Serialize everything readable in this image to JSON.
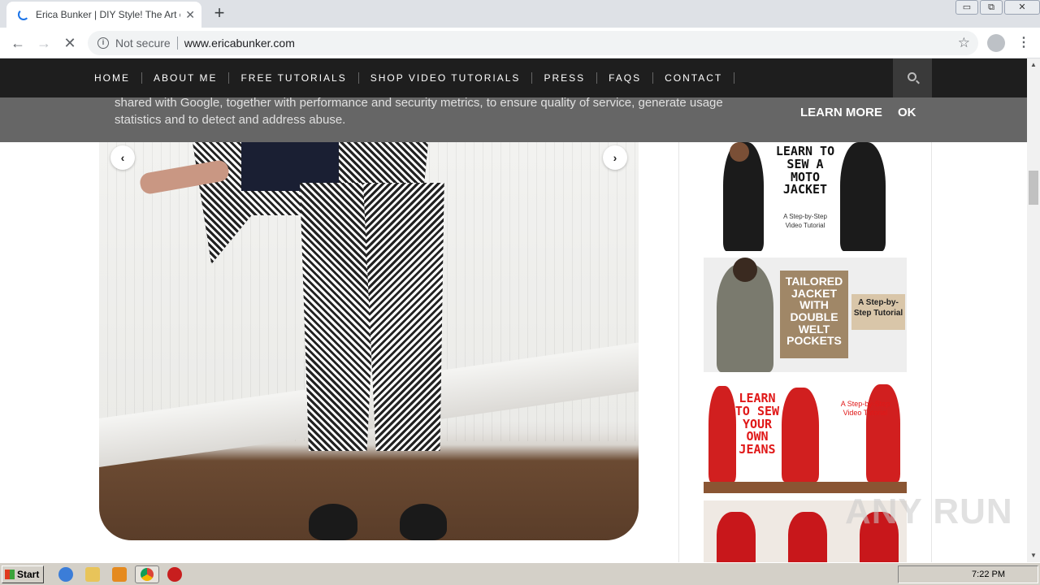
{
  "browser": {
    "tab_title": "Erica Bunker | DIY Style! The Art of (",
    "tab_close": "✕",
    "new_tab": "+",
    "window_controls": {
      "minimize": "▭",
      "restore": "⧉",
      "close": "✕"
    },
    "back": "←",
    "forward": "→",
    "reload": "✕",
    "security_label": "Not secure",
    "url": "www.ericabunker.com",
    "bookmark": "☆",
    "menu": "⋮"
  },
  "site_nav": {
    "items": [
      "HOME",
      "ABOUT ME",
      "FREE TUTORIALS",
      "SHOP VIDEO TUTORIALS",
      "PRESS",
      "FAQS",
      "CONTACT"
    ]
  },
  "cookie_banner": {
    "text": "shared with Google, together with performance and security metrics, to ensure quality of service, generate usage statistics and to detect and address abuse.",
    "learn_more": "LEARN MORE",
    "ok": "OK"
  },
  "slider": {
    "prev": "‹",
    "next": "›"
  },
  "sidebar": {
    "promo1": {
      "title": "LEARN TO SEW A MOTO JACKET",
      "subtitle": "A Step-by-Step Video Tutorial"
    },
    "promo2": {
      "title": "TAILORED JACKET WITH DOUBLE WELT POCKETS",
      "subtitle": "A Step-by-Step Tutorial"
    },
    "promo3": {
      "title": "LEARN TO SEW YOUR OWN JEANS",
      "subtitle": "A Step-by-Step Video Tutorial"
    }
  },
  "scrollbar": {
    "up": "▲",
    "down": "▼"
  },
  "watermark": "ANY RUN",
  "taskbar": {
    "start": "Start",
    "clock": "7:22 PM"
  }
}
